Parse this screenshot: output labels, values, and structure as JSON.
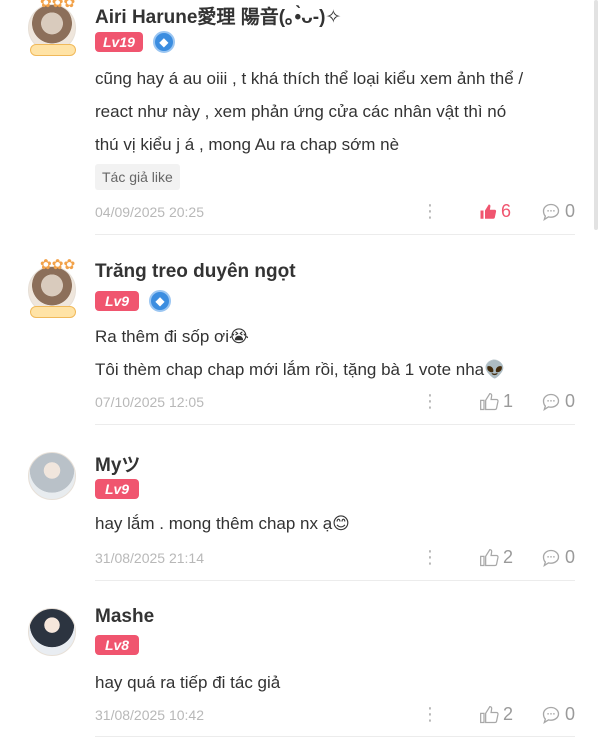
{
  "comments": [
    {
      "username": "Airi Harune愛理 陽音(｡•̀ᴗ-)✧",
      "level": "Lv19",
      "has_medal": true,
      "text_lines": [
        "cũng hay á au oiii , t khá thích thể loại  kiểu xem ảnh thể /",
        "react như này  , xem phản ứng cửa các nhân vật thì nó",
        "thú vị kiểu j á , mong Au ra chap sớm nè"
      ],
      "tag": "Tác giả like",
      "date": "04/09/2025 20:25",
      "likes": "6",
      "liked": true,
      "replies": "0"
    },
    {
      "username": "Trăng treo duyên ngọt",
      "level": "Lv9",
      "has_medal": true,
      "text_lines": [
        "Ra thêm đi sốp ơi😭",
        "Tôi thèm chap chap mới lắm rồi, tặng bà 1 vote nha👽"
      ],
      "date": "07/10/2025 12:05",
      "likes": "1",
      "liked": false,
      "replies": "0"
    },
    {
      "username": "Myツ",
      "level": "Lv9",
      "text_lines": [
        "hay lắm . mong thêm chap nx ạ😊"
      ],
      "date": "31/08/2025 21:14",
      "likes": "2",
      "liked": false,
      "replies": "0"
    },
    {
      "username": "Mashe",
      "level": "Lv8",
      "text_lines": [
        "hay quá ra tiếp đi tác giả"
      ],
      "date": "31/08/2025 10:42",
      "likes": "2",
      "liked": false,
      "replies": "0"
    }
  ],
  "icons": {
    "more": "more-vertical-icon",
    "like": "thumbs-up-icon",
    "reply": "chat-bubble-icon",
    "medal": "medal-icon"
  },
  "colors": {
    "accent": "#f0556f",
    "medal": "#3b8de0"
  }
}
